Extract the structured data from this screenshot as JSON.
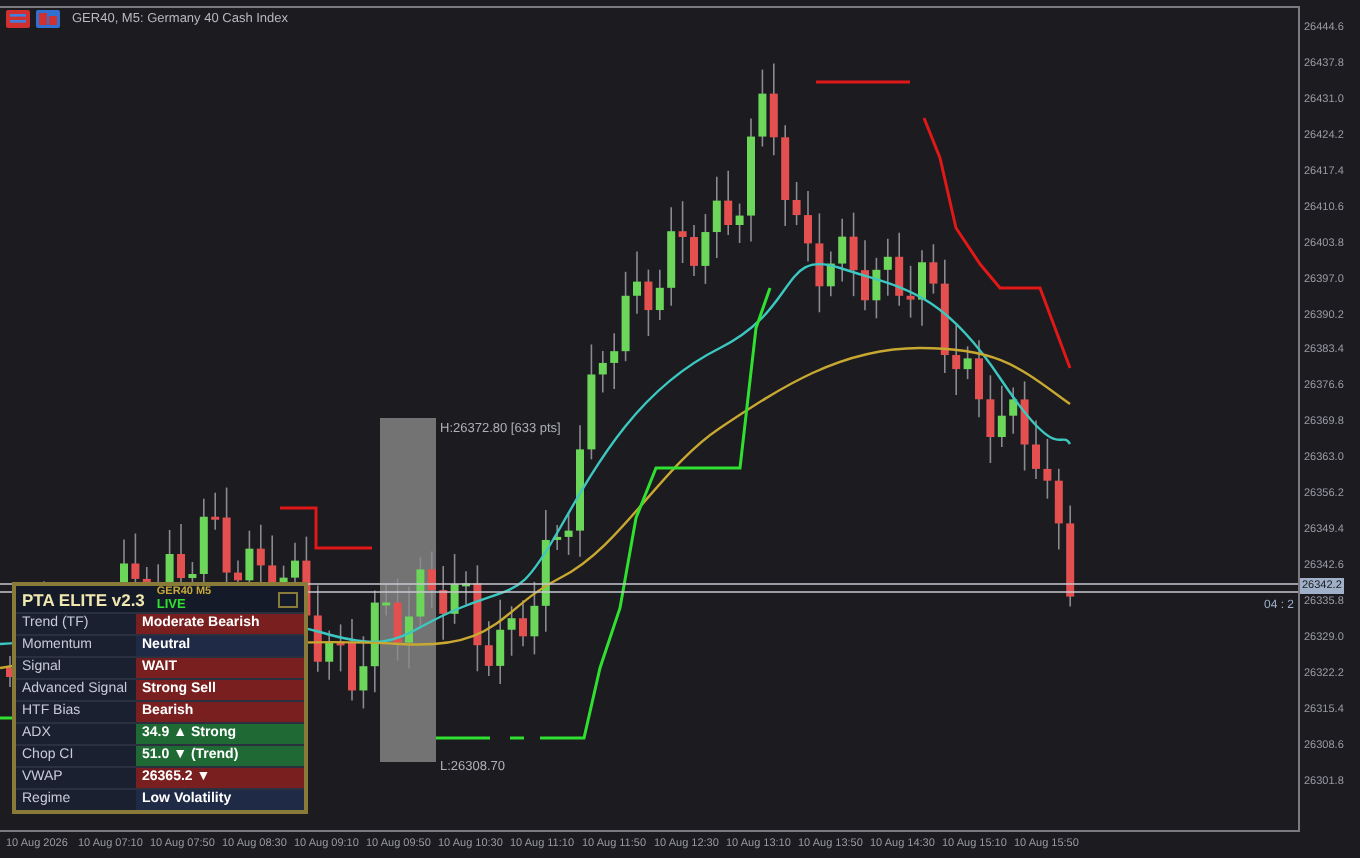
{
  "title": "GER40, M5:  Germany 40 Cash Index",
  "range_box": {
    "high": "H:26372.80  [633 pts]",
    "low": "L:26308.70"
  },
  "price_axis": [
    "26444.6",
    "26437.8",
    "26431.0",
    "26424.2",
    "26417.4",
    "26410.6",
    "26403.8",
    "26397.0",
    "26390.2",
    "26383.4",
    "26376.6",
    "26369.8",
    "26363.0",
    "26356.2",
    "26349.4",
    "26342.6",
    "26335.8",
    "26329.0",
    "26322.2",
    "26315.4",
    "26308.6",
    "26301.8"
  ],
  "price_tag": "26342.2",
  "countdown": "04 : 2",
  "time_axis": [
    "10 Aug 2026",
    "10 Aug 07:10",
    "10 Aug 07:50",
    "10 Aug 08:30",
    "10 Aug 09:10",
    "10 Aug 09:50",
    "10 Aug 10:30",
    "10 Aug 11:10",
    "10 Aug 11:50",
    "10 Aug 12:30",
    "10 Aug 13:10",
    "10 Aug 13:50",
    "10 Aug 14:30",
    "10 Aug 15:10",
    "10 Aug 15:50"
  ],
  "panel": {
    "title": "PTA ELITE v2.3",
    "symbol": "GER40 M5",
    "status": "LIVE",
    "rows": [
      {
        "label": "Trend (TF)",
        "value": "Moderate Bearish",
        "kind": "bearish"
      },
      {
        "label": "Momentum",
        "value": "Neutral",
        "kind": "neutral"
      },
      {
        "label": "Signal",
        "value": "WAIT",
        "kind": "bearish"
      },
      {
        "label": "Advanced Signal",
        "value": "Strong Sell",
        "kind": "bearish"
      },
      {
        "label": "HTF Bias",
        "value": "Bearish",
        "kind": "bearish"
      },
      {
        "label": "ADX",
        "value": "34.9 ▲ Strong",
        "kind": "bullish"
      },
      {
        "label": "Chop CI",
        "value": "51.0 ▼ (Trend)",
        "kind": "bullish"
      },
      {
        "label": "VWAP",
        "value": "26365.2 ▼",
        "kind": "bearish"
      },
      {
        "label": "Regime",
        "value": "Low Volatility",
        "kind": "neutral"
      }
    ]
  }
}
